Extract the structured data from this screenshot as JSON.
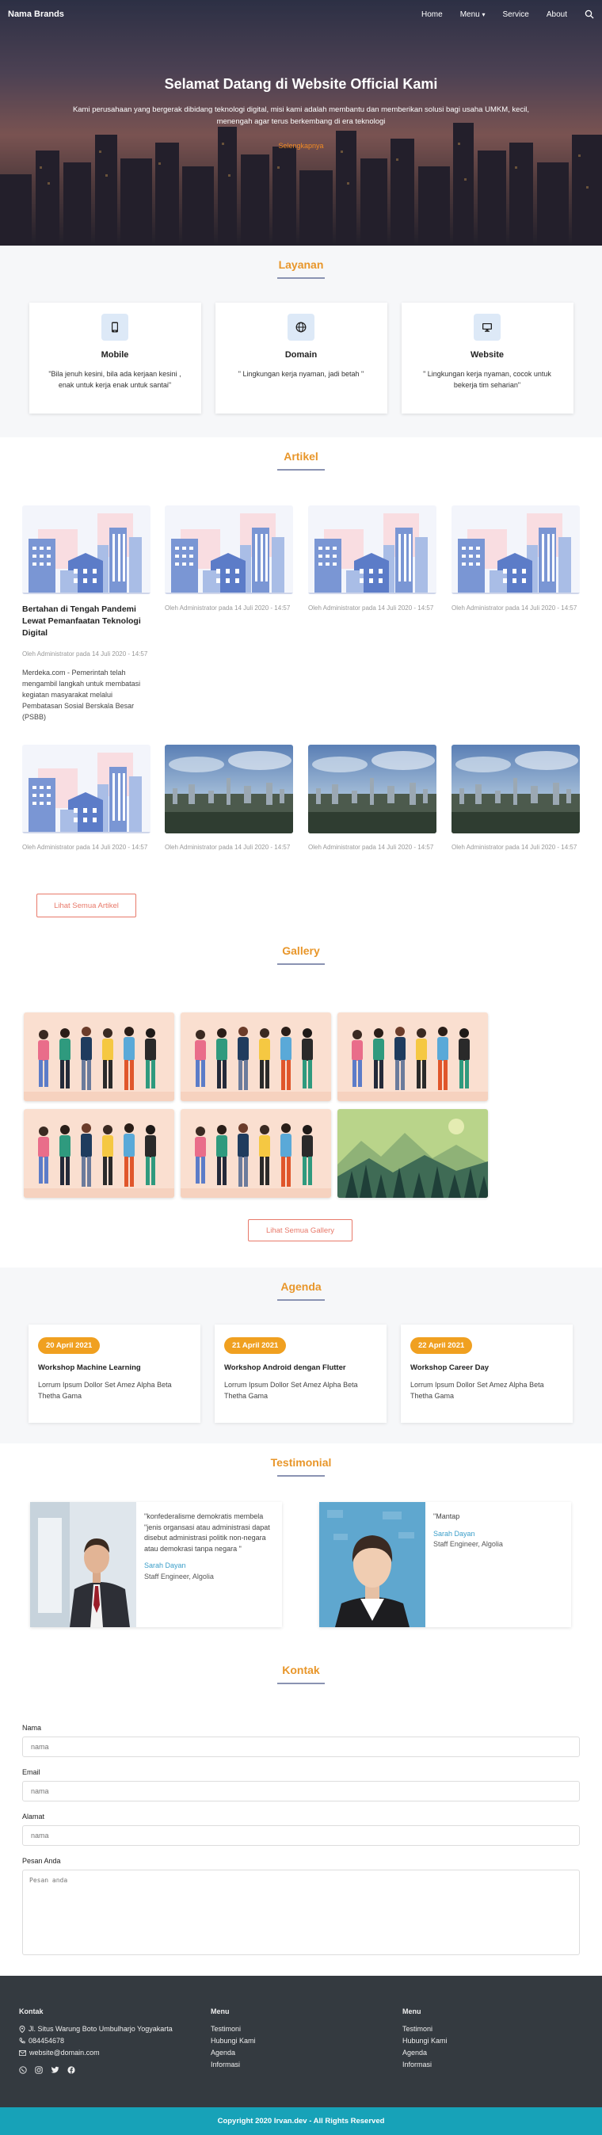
{
  "nav": {
    "brand": "Nama Brands",
    "links": [
      "Home",
      "Menu",
      "Service",
      "About"
    ],
    "menu_caret": "▾"
  },
  "hero": {
    "title": "Selamat Datang di Website Official Kami",
    "subtitle": "Kami perusahaan yang bergerak dibidang teknologi digital, misi kami adalah membantu dan memberikan solusi bagi usaha UMKM, kecil, menengah agar terus berkembang di era teknologi",
    "cta": "Selengkapnya"
  },
  "layanan": {
    "title": "Layanan",
    "items": [
      {
        "icon": "mobile-icon",
        "name": "Mobile",
        "desc": "\"Bila jenuh kesini, bila ada kerjaan kesini , enak untuk kerja enak untuk santai\""
      },
      {
        "icon": "globe-icon",
        "name": "Domain",
        "desc": "\" Lingkungan kerja nyaman, jadi betah \""
      },
      {
        "icon": "monitor-icon",
        "name": "Website",
        "desc": "\" Lingkungan kerja nyaman, cocok untuk bekerja tim seharian\""
      }
    ]
  },
  "artikel": {
    "title": "Artikel",
    "featured": {
      "title": "Bertahan di Tengah Pandemi Lewat Pemanfaatan Teknologi Digital",
      "meta": "Oleh Administrator pada 14 Juli 2020 - 14:57",
      "excerpt": "Merdeka.com - Pemerintah telah mengambil langkah untuk membatasi kegiatan masyarakat melalui Pembatasan Sosial Berskala Besar (PSBB)"
    },
    "meta_text": "Oleh Administrator pada 14 Juli 2020 - 14:57",
    "row1_images": [
      "illustration",
      "illustration",
      "illustration",
      "illustration"
    ],
    "row2_images": [
      "illustration",
      "city",
      "city",
      "city"
    ],
    "button": "Lihat Semua Artikel"
  },
  "gallery": {
    "title": "Gallery",
    "images": [
      "people",
      "people",
      "people",
      "people",
      "people",
      "landscape"
    ],
    "button": "Lihat Semua Gallery"
  },
  "agenda": {
    "title": "Agenda",
    "items": [
      {
        "date": "20 April 2021",
        "title": "Workshop Machine Learning",
        "desc": "Lorrum Ipsum Dollor Set Amez Alpha Beta Thetha Gama"
      },
      {
        "date": "21 April 2021",
        "title": "Workshop Android dengan Flutter",
        "desc": "Lorrum Ipsum Dollor Set Amez Alpha Beta Thetha Gama"
      },
      {
        "date": "22 April 2021",
        "title": "Workshop Career Day",
        "desc": "Lorrum Ipsum Dollor Set Amez Alpha Beta Thetha Gama"
      }
    ]
  },
  "testimonial": {
    "title": "Testimonial",
    "items": [
      {
        "quote": "\"konfederalisme demokratis membela \"jenis organsasi atau administrasi dapat disebut administrasi politik non-negara atau demokrasi tanpa negara \"",
        "name": "Sarah Dayan",
        "role": "Staff Engineer, Algolia"
      },
      {
        "quote": "\"Mantap",
        "name": "Sarah Dayan",
        "role": "Staff Engineer, Algolia"
      }
    ]
  },
  "kontak": {
    "title": "Kontak",
    "fields": [
      {
        "label": "Nama",
        "placeholder": "nama"
      },
      {
        "label": "Email",
        "placeholder": "nama"
      },
      {
        "label": "Alamat",
        "placeholder": "nama"
      }
    ],
    "message_label": "Pesan Anda",
    "message_placeholder": "Pesan anda"
  },
  "footer": {
    "contact_head": "Kontak",
    "address": "Jl. Situs Warung Boto Umbulharjo Yogyakarta",
    "phone": "084454678",
    "email": "website@domain.com",
    "menu1_head": "Menu",
    "menu1": [
      "Testimoni",
      "Hubungi Kami",
      "Agenda",
      "Informasi"
    ],
    "menu2_head": "Menu",
    "menu2": [
      "Testimoni",
      "Hubungi Kami",
      "Agenda",
      "Informasi"
    ],
    "social": [
      "whatsapp-icon",
      "instagram-icon",
      "twitter-icon",
      "facebook-icon"
    ],
    "copyright": "Copyright 2020 Irvan.dev - All Rights Reserved"
  },
  "colors": {
    "accent": "#e8962a",
    "button_outline": "#e8796a",
    "footer_bg": "#343a40",
    "copyright_bg": "#17a2b8",
    "date_pill": "#f0a020"
  }
}
